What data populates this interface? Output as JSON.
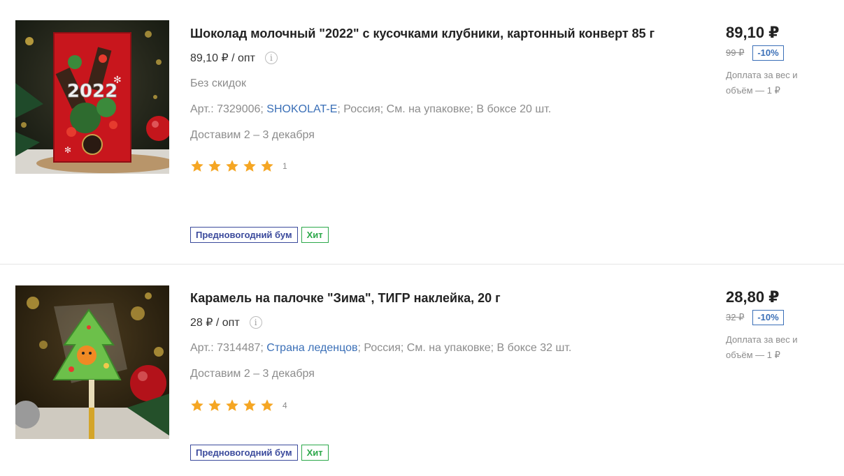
{
  "currency_glyph": "₽",
  "colors": {
    "star": "#f5a623",
    "link": "#3a6fb7",
    "badge_promo": "#3b4a9c",
    "badge_hit": "#2ca84a",
    "muted_text": "#8c8c8c"
  },
  "products": [
    {
      "title": "Шоколад молочный \"2022\" с кусочками клубники, картонный конверт 85 г",
      "image_icon": "chocolate-2022-package-image",
      "opt_price": "89,10 ₽ / опт",
      "no_discount": "Без скидок",
      "art_label": "Арт.: 7329006;",
      "brand": "SHOKOLAT-E",
      "sep1": ";",
      "country": "Россия;",
      "expiry": "См. на упаковке;",
      "box": "В боксе 20 шт.",
      "delivery": "Доставим 2 – 3 декабря",
      "rating_stars": 5,
      "rating_count": "1",
      "badges": [
        "Предновогодний бум",
        "Хит"
      ],
      "price": "89,10 ₽",
      "old_price": "99 ₽",
      "discount": "-10%",
      "surcharge": "Доплата за вес и объём — 1 ₽"
    },
    {
      "title": "Карамель на палочке \"Зима\", ТИГР наклейка, 20 г",
      "image_icon": "christmas-tree-lollipop-image",
      "opt_price": "28 ₽ / опт",
      "art_label": "Арт.: 7314487;",
      "brand": "Страна леденцов",
      "sep1": ";",
      "country": "Россия;",
      "expiry": "См. на упаковке;",
      "box": "В боксе 32 шт.",
      "delivery": "Доставим 2 – 3 декабря",
      "rating_stars": 5,
      "rating_count": "4",
      "badges": [
        "Предновогодний бум",
        "Хит"
      ],
      "price": "28,80 ₽",
      "old_price": "32 ₽",
      "discount": "-10%",
      "surcharge": "Доплата за вес и объём — 1 ₽"
    }
  ]
}
